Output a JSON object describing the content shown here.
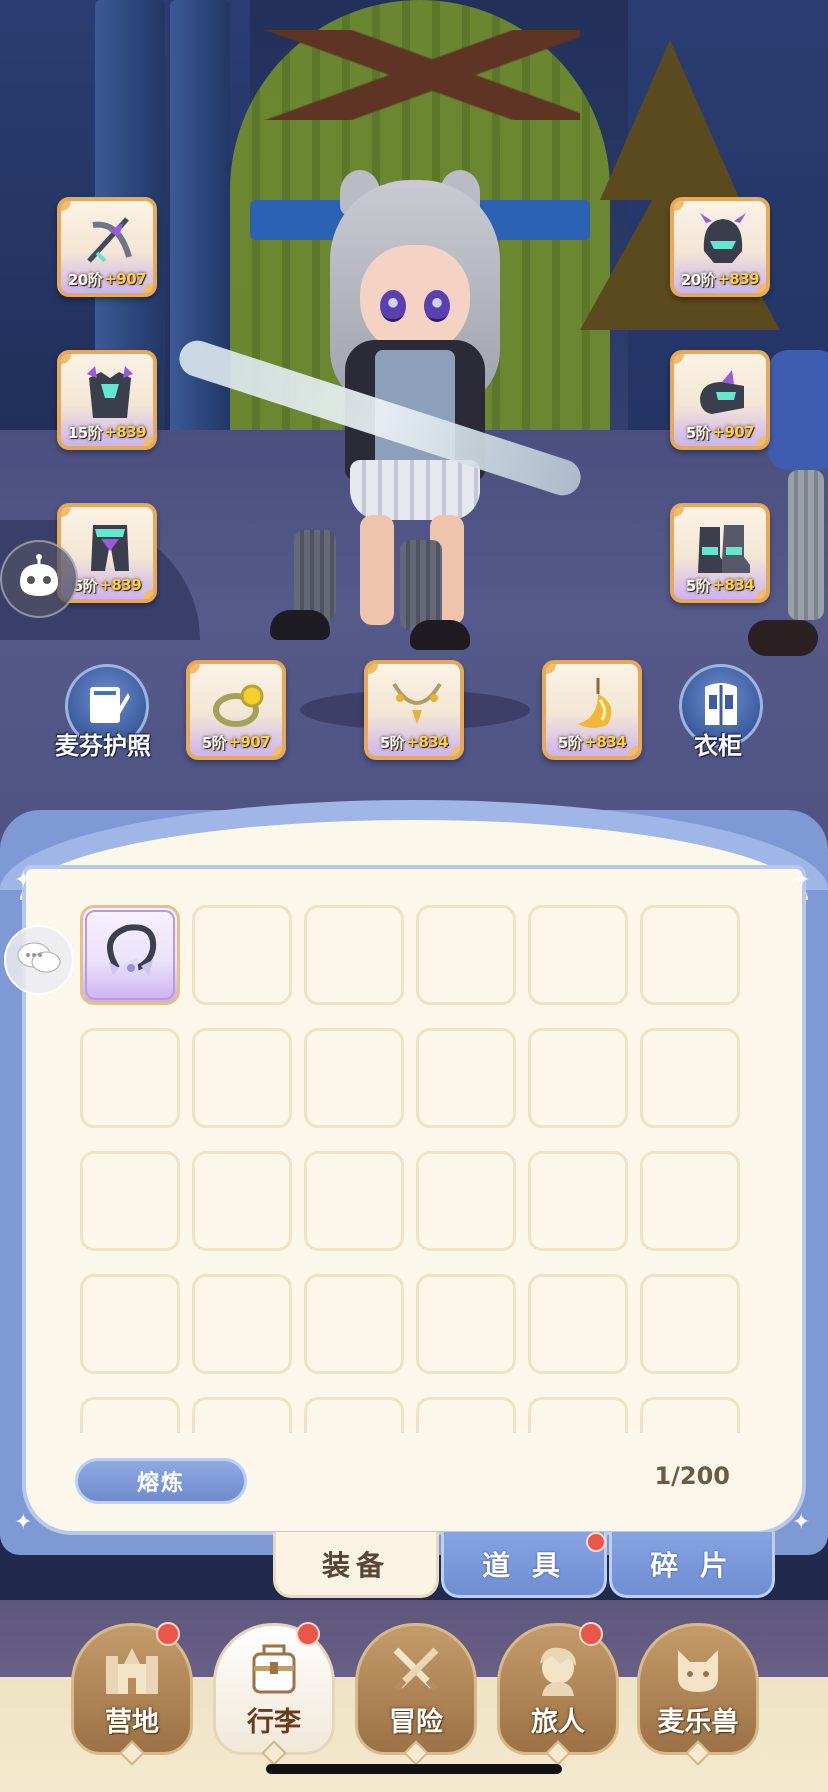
{
  "equipment_slots": [
    {
      "id": "weapon",
      "tier": "20阶",
      "bonus": "+907",
      "icon": "bow-icon"
    },
    {
      "id": "helmet",
      "tier": "20阶",
      "bonus": "+839",
      "icon": "helmet-icon"
    },
    {
      "id": "armor",
      "tier": "15阶",
      "bonus": "+839",
      "icon": "armor-icon"
    },
    {
      "id": "gauntlet",
      "tier": "5阶",
      "bonus": "+907",
      "icon": "gauntlet-icon"
    },
    {
      "id": "pants",
      "tier": "5阶",
      "bonus": "+839",
      "icon": "pants-icon"
    },
    {
      "id": "boots",
      "tier": "5阶",
      "bonus": "+834",
      "icon": "boots-icon"
    },
    {
      "id": "ring",
      "tier": "5阶",
      "bonus": "+907",
      "icon": "ring-icon"
    },
    {
      "id": "necklace",
      "tier": "5阶",
      "bonus": "+834",
      "icon": "necklace-icon"
    },
    {
      "id": "charm",
      "tier": "5阶",
      "bonus": "+834",
      "icon": "charm-icon"
    }
  ],
  "buttons": {
    "passport": "麦芬护照",
    "wardrobe": "衣柜",
    "smelt": "熔炼"
  },
  "inventory": {
    "count": "1/200",
    "items": [
      {
        "icon": "hair-tie-icon",
        "rarity": "purple"
      }
    ]
  },
  "tabs": [
    {
      "label": "装备",
      "active": true,
      "badge": false
    },
    {
      "label": "道 具",
      "active": false,
      "badge": true
    },
    {
      "label": "碎 片",
      "active": false,
      "badge": false
    }
  ],
  "nav": [
    {
      "label": "营地",
      "badge": true,
      "active": false,
      "icon": "castle-icon"
    },
    {
      "label": "行李",
      "badge": true,
      "active": true,
      "icon": "backpack-icon"
    },
    {
      "label": "冒险",
      "badge": false,
      "active": false,
      "icon": "crossed-swords-icon"
    },
    {
      "label": "旅人",
      "badge": true,
      "active": false,
      "icon": "traveler-icon"
    },
    {
      "label": "麦乐兽",
      "badge": false,
      "active": false,
      "icon": "cat-pet-icon"
    }
  ],
  "colors": {
    "panel_bg": "#fbf7ea",
    "panel_frame": "#7f99d4",
    "slot_border": "#e6a95a",
    "bonus_text": "#ffcf4a",
    "badge_red": "#e8574a"
  }
}
